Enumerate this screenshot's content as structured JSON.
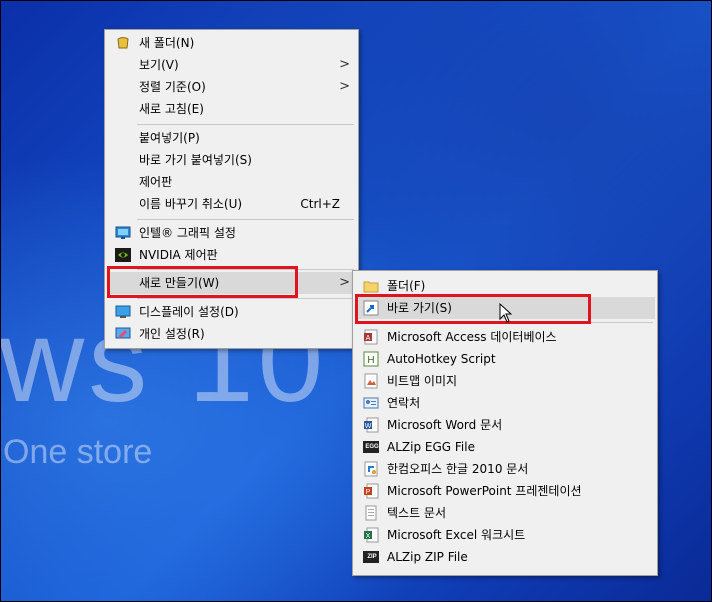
{
  "wallpaper": {
    "big_text": "ws 10",
    "small_text": "One store"
  },
  "context_menu": {
    "items": [
      {
        "label": "새 폴더(N)",
        "icon": "new-folder-icon"
      },
      {
        "label": "보기(V)",
        "submenu": true
      },
      {
        "label": "정렬 기준(O)",
        "submenu": true
      },
      {
        "label": "새로 고침(E)"
      },
      {
        "label": "붙여넣기(P)"
      },
      {
        "label": "바로 가기 붙여넣기(S)"
      },
      {
        "label": "제어판"
      },
      {
        "label": "이름 바꾸기 취소(U)",
        "shortcut": "Ctrl+Z"
      },
      {
        "label": "인텔® 그래픽 설정",
        "icon": "intel-graphics-icon"
      },
      {
        "label": "NVIDIA 제어판",
        "icon": "nvidia-icon"
      },
      {
        "label": "새로 만들기(W)",
        "submenu": true,
        "highlighted": true
      },
      {
        "label": "디스플레이 설정(D)",
        "icon": "display-icon"
      },
      {
        "label": "개인 설정(R)",
        "icon": "personalize-icon"
      }
    ],
    "arrow_glyph": ">"
  },
  "submenu": {
    "items": [
      {
        "label": "폴더(F)",
        "icon": "folder-icon"
      },
      {
        "label": "바로 가기(S)",
        "icon": "shortcut-icon",
        "highlighted": true
      },
      {
        "label": "Microsoft Access 데이터베이스",
        "icon": "access-icon"
      },
      {
        "label": "AutoHotkey Script",
        "icon": "autohotkey-icon"
      },
      {
        "label": "비트맵 이미지",
        "icon": "bitmap-icon"
      },
      {
        "label": "연락처",
        "icon": "contact-icon"
      },
      {
        "label": "Microsoft Word 문서",
        "icon": "word-icon"
      },
      {
        "label": "ALZip EGG File",
        "icon": "alzip-egg-icon",
        "badge": "EGG"
      },
      {
        "label": "한컴오피스 한글 2010 문서",
        "icon": "hwp-icon"
      },
      {
        "label": "Microsoft PowerPoint 프레젠테이션",
        "icon": "powerpoint-icon"
      },
      {
        "label": "텍스트 문서",
        "icon": "text-document-icon"
      },
      {
        "label": "Microsoft Excel 워크시트",
        "icon": "excel-icon"
      },
      {
        "label": "ALZip ZIP File",
        "icon": "alzip-zip-icon",
        "badge": "ZIP"
      }
    ]
  },
  "colors": {
    "highlight_box": "#e0141e",
    "menu_bg": "#f0f0f0",
    "hover_bg": "#d9d9d9"
  }
}
